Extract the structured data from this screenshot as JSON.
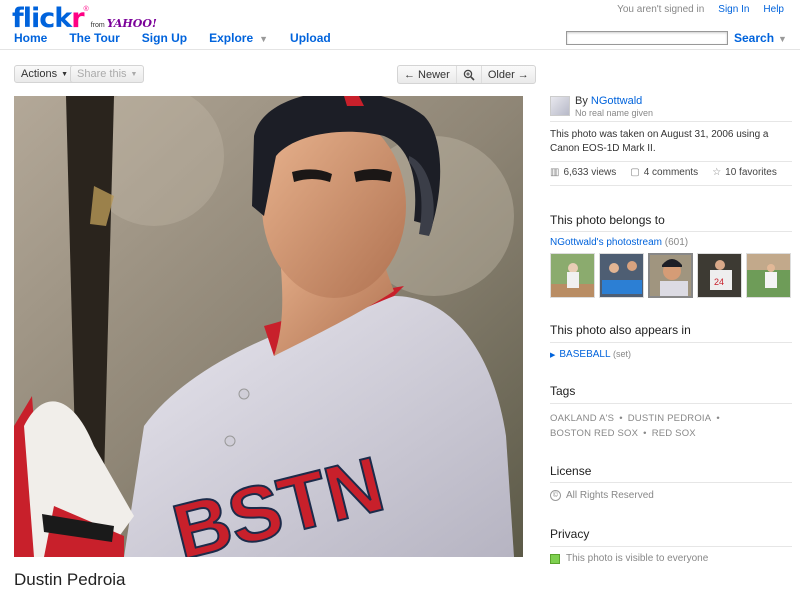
{
  "brand": {
    "flick": "flick",
    "r": "r",
    "reg": "®",
    "from": "from",
    "yahoo": "YAHOO!"
  },
  "top_right": {
    "status": "You aren't signed in",
    "sign_in": "Sign In",
    "help": "Help"
  },
  "nav": {
    "home": "Home",
    "tour": "The Tour",
    "signup": "Sign Up",
    "explore": "Explore",
    "upload": "Upload"
  },
  "search": {
    "button": "Search",
    "value": ""
  },
  "toolbar": {
    "actions": "Actions",
    "share": "Share this",
    "newer": "← Newer",
    "older": "Older →"
  },
  "photo": {
    "title": "Dustin Pedroia"
  },
  "owner": {
    "by": "By",
    "name": "NGottwald",
    "real_name": "No real name given"
  },
  "meta": {
    "taken": "This photo was taken on August 31, 2006 using a Canon EOS-1D Mark II."
  },
  "stats": {
    "views": "6,633 views",
    "comments": "4 comments",
    "favorites": "10 favorites"
  },
  "belongs": {
    "heading": "This photo belongs to",
    "stream": "NGottwald's photostream",
    "count": "(601)"
  },
  "appears": {
    "heading": "This photo also appears in",
    "set": "BASEBALL",
    "set_label": "(set)"
  },
  "tags": {
    "heading": "Tags",
    "items": [
      "OAKLAND A'S",
      "DUSTIN PEDROIA",
      "BOSTON RED SOX",
      "RED SOX"
    ]
  },
  "license": {
    "heading": "License",
    "text": "All Rights Reserved",
    "icon": "©"
  },
  "privacy": {
    "heading": "Privacy",
    "text": "This photo is visible to everyone"
  },
  "colors": {
    "link": "#0063dc",
    "pink": "#ff0084",
    "yahoo": "#7b0099",
    "privacy_green": "#7ed04f"
  }
}
